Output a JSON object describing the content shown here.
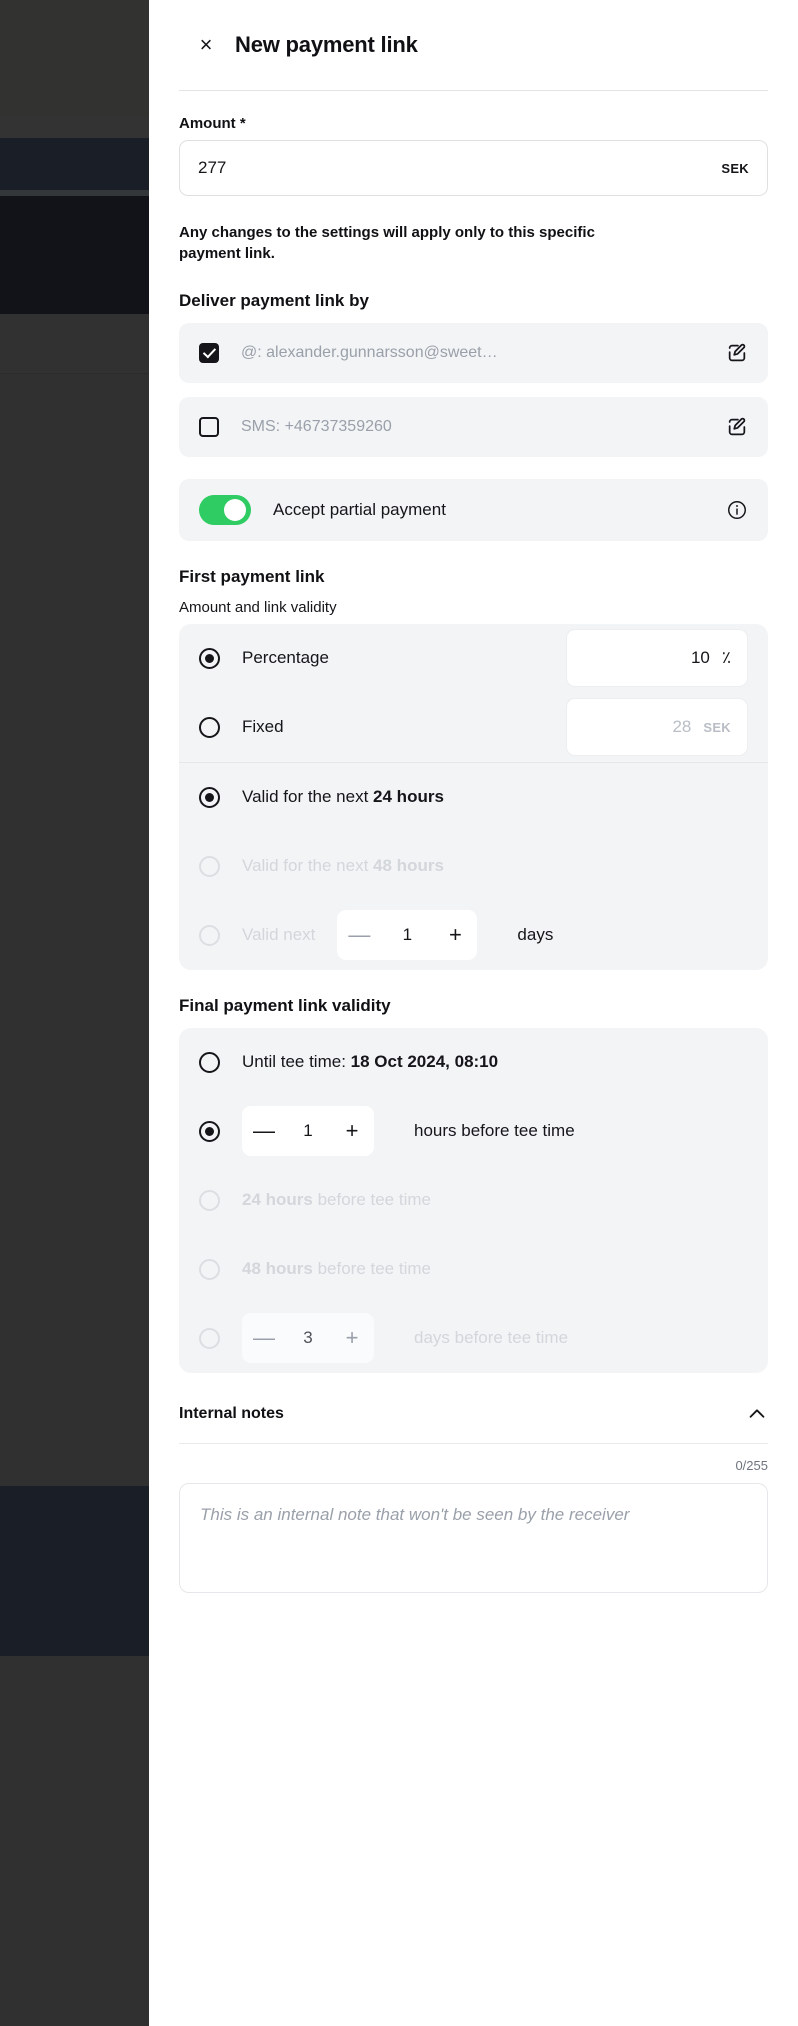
{
  "header": {
    "close_label": "×",
    "title": "New payment link"
  },
  "amount": {
    "label": "Amount *",
    "value": "277",
    "currency": "SEK"
  },
  "disclaimer": "Any changes to the settings will apply only to this specific payment link.",
  "deliver": {
    "heading": "Deliver payment link by",
    "options": [
      {
        "checked": true,
        "text": "@: alexander.gunnarsson@sweet…"
      },
      {
        "checked": false,
        "text": "SMS: +46737359260"
      }
    ]
  },
  "partial": {
    "label": "Accept partial payment",
    "enabled": true,
    "accent": "#2ecc62"
  },
  "first_link": {
    "heading": "First payment link",
    "subheading": "Amount and link validity",
    "percentage": {
      "label": "Percentage",
      "selected": true,
      "value": "10",
      "suffix": "٪"
    },
    "fixed": {
      "label": "Fixed",
      "selected": false,
      "placeholder": "28",
      "currency": "SEK"
    },
    "validity": [
      {
        "prefix": "Valid for the next ",
        "strong": "24 hours",
        "selected": true,
        "dim": false
      },
      {
        "prefix": "Valid for the next ",
        "strong": "48 hours",
        "selected": false,
        "dim": true
      }
    ],
    "custom_days": {
      "label": "Valid next",
      "selected": false,
      "value": "1",
      "unit": "days",
      "minus": "—",
      "plus": "+"
    }
  },
  "final_link": {
    "heading": "Final payment link validity",
    "until_tee": {
      "prefix": "Until tee time: ",
      "strong": "18 Oct 2024, 08:10",
      "selected": false
    },
    "hours_stepper": {
      "selected": true,
      "value": "1",
      "suffix": "hours before tee time",
      "minus": "—",
      "plus": "+"
    },
    "presets": [
      {
        "strong": "24 hours",
        "rest": " before tee time",
        "selected": false
      },
      {
        "strong": "48 hours",
        "rest": " before tee time",
        "selected": false
      }
    ],
    "days_stepper": {
      "selected": false,
      "value": "3",
      "suffix": "days before tee time",
      "minus": "—",
      "plus": "+"
    }
  },
  "internal_notes": {
    "title": "Internal notes",
    "counter": "0/255",
    "placeholder": "This is an internal note that won't be seen by the receiver"
  }
}
